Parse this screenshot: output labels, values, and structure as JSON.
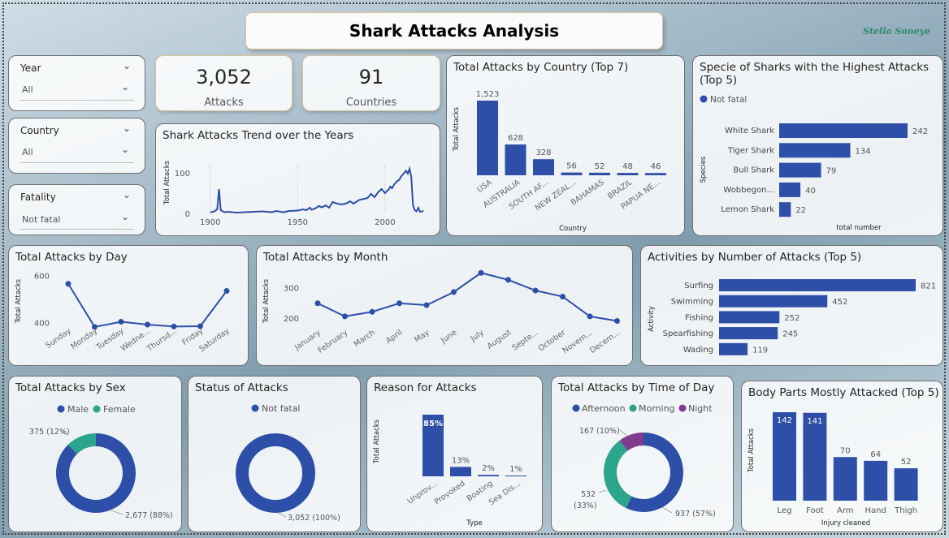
{
  "header": {
    "title": "Shark Attacks Analysis",
    "author": "Stella Soneye"
  },
  "slicers": [
    {
      "label": "Year",
      "value": "All"
    },
    {
      "label": "Country",
      "value": "All"
    },
    {
      "label": "Fatality",
      "value": "Not fatal"
    }
  ],
  "kpis": [
    {
      "value": "3,052",
      "label": "Attacks"
    },
    {
      "value": "91",
      "label": "Countries"
    }
  ],
  "colors": {
    "blue": "#2E4FA8",
    "teal": "#2BA58B",
    "purple": "#7E3C8F"
  },
  "chart_data": [
    {
      "id": "trend",
      "type": "line",
      "title": "Shark Attacks Trend over the Years",
      "xlabel": "",
      "ylabel": "Total Attacks",
      "xticks": [
        "1900",
        "1950",
        "2000"
      ],
      "yticks": [
        "0",
        "100"
      ],
      "xlim": [
        1895,
        2027
      ],
      "ylim": [
        0,
        120
      ],
      "x": [
        1900,
        1902,
        1904,
        1905,
        1906,
        1908,
        1910,
        1915,
        1920,
        1925,
        1930,
        1935,
        1938,
        1940,
        1942,
        1945,
        1950,
        1953,
        1955,
        1957,
        1958,
        1960,
        1962,
        1964,
        1966,
        1968,
        1970,
        1972,
        1975,
        1978,
        1980,
        1982,
        1985,
        1988,
        1990,
        1992,
        1994,
        1996,
        1998,
        2000,
        2001,
        2002,
        2003,
        2004,
        2005,
        2006,
        2007,
        2008,
        2009,
        2010,
        2011,
        2012,
        2013,
        2014,
        2015,
        2016,
        2017,
        2018,
        2019,
        2020,
        2021,
        2022
      ],
      "values": [
        3,
        4,
        10,
        60,
        8,
        3,
        4,
        2,
        3,
        4,
        5,
        3,
        6,
        4,
        3,
        6,
        7,
        10,
        8,
        14,
        9,
        12,
        18,
        15,
        20,
        14,
        28,
        25,
        22,
        25,
        30,
        24,
        33,
        36,
        38,
        48,
        40,
        52,
        60,
        50,
        55,
        58,
        66,
        62,
        70,
        75,
        80,
        82,
        90,
        95,
        100,
        105,
        98,
        110,
        90,
        20,
        8,
        5,
        14,
        4,
        5,
        6
      ]
    },
    {
      "id": "country",
      "type": "bar",
      "title": "Total Attacks by Country (Top 7)",
      "xlabel": "Country",
      "ylabel": "Total Attacks",
      "categories": [
        "USA",
        "AUSTRALIA",
        "SOUTH AF...",
        "NEW ZEAL...",
        "BAHAMAS",
        "BRAZIL",
        "PAPUA NE..."
      ],
      "values": [
        1523,
        628,
        328,
        56,
        52,
        48,
        46
      ],
      "data_labels": [
        "1,523",
        "628",
        "328",
        "56",
        "52",
        "48",
        "46"
      ]
    },
    {
      "id": "species",
      "type": "bar",
      "title": "Specie of Sharks with the Highest Attacks (Top 5)",
      "xlabel": "total number",
      "ylabel": "Species",
      "legend": [
        "Not fatal"
      ],
      "categories": [
        "White Shark",
        "Tiger Shark",
        "Bull Shark",
        "Wobbegon...",
        "Lemon Shark"
      ],
      "values": [
        242,
        134,
        79,
        40,
        22
      ]
    },
    {
      "id": "day",
      "type": "line",
      "title": "Total Attacks by Day",
      "xlabel": "",
      "ylabel": "Total Attacks",
      "categories": [
        "Sunday",
        "Monday",
        "Tuesday",
        "Wedne...",
        "Thursd...",
        "Friday",
        "Saturday"
      ],
      "values": [
        565,
        382,
        404,
        392,
        384,
        385,
        535
      ],
      "yticks": [
        "400",
        "600"
      ],
      "ylim": [
        330,
        640
      ]
    },
    {
      "id": "month",
      "type": "line",
      "title": "Total Attacks by Month",
      "xlabel": "",
      "ylabel": "Total Attacks",
      "categories": [
        "January",
        "February",
        "March",
        "April",
        "May",
        "June",
        "July",
        "August",
        "Septe...",
        "October",
        "Novem...",
        "Decem..."
      ],
      "values": [
        248,
        205,
        220,
        248,
        242,
        285,
        348,
        325,
        290,
        270,
        205,
        190
      ],
      "yticks": [
        "200",
        "300"
      ],
      "ylim": [
        130,
        370
      ]
    },
    {
      "id": "activity",
      "type": "bar",
      "title": "Activities by Number of Attacks (Top 5)",
      "xlabel": "",
      "ylabel": "Activity",
      "categories": [
        "Surfing",
        "Swimming",
        "Fishing",
        "Spearfishing",
        "Wading"
      ],
      "values": [
        821,
        452,
        252,
        245,
        119
      ]
    },
    {
      "id": "sex",
      "type": "pie",
      "title": "Total Attacks by Sex",
      "legend": [
        "Male",
        "Female"
      ],
      "values": [
        2677,
        375
      ],
      "data_labels": [
        "2,677 (88%)",
        "375 (12%)"
      ]
    },
    {
      "id": "status",
      "type": "pie",
      "title": "Status of Attacks",
      "legend": [
        "Not fatal"
      ],
      "values": [
        3052
      ],
      "data_labels": [
        "3,052 (100%)"
      ]
    },
    {
      "id": "reason",
      "type": "bar",
      "title": "Reason for Attacks",
      "xlabel": "Type",
      "ylabel": "Total Attacks",
      "categories": [
        "Unprov...",
        "Provoked",
        "Boating",
        "Sea Dis..."
      ],
      "values": [
        85,
        13,
        2,
        1
      ],
      "data_labels": [
        "85%",
        "13%",
        "2%",
        "1%"
      ]
    },
    {
      "id": "timeofday",
      "type": "pie",
      "title": "Total Attacks by Time of Day",
      "legend": [
        "Afternoon",
        "Morning",
        "Night"
      ],
      "values": [
        937,
        532,
        167
      ],
      "data_labels": [
        "937 (57%)",
        "532 (33%)",
        "167 (10%)"
      ]
    },
    {
      "id": "bodyparts",
      "type": "bar",
      "title": "Body Parts Mostly Attacked (Top 5)",
      "xlabel": "Injury cleaned",
      "ylabel": "Total Attacks",
      "categories": [
        "Leg",
        "Foot",
        "Arm",
        "Hand",
        "Thigh"
      ],
      "values": [
        142,
        141,
        70,
        64,
        52
      ]
    }
  ]
}
